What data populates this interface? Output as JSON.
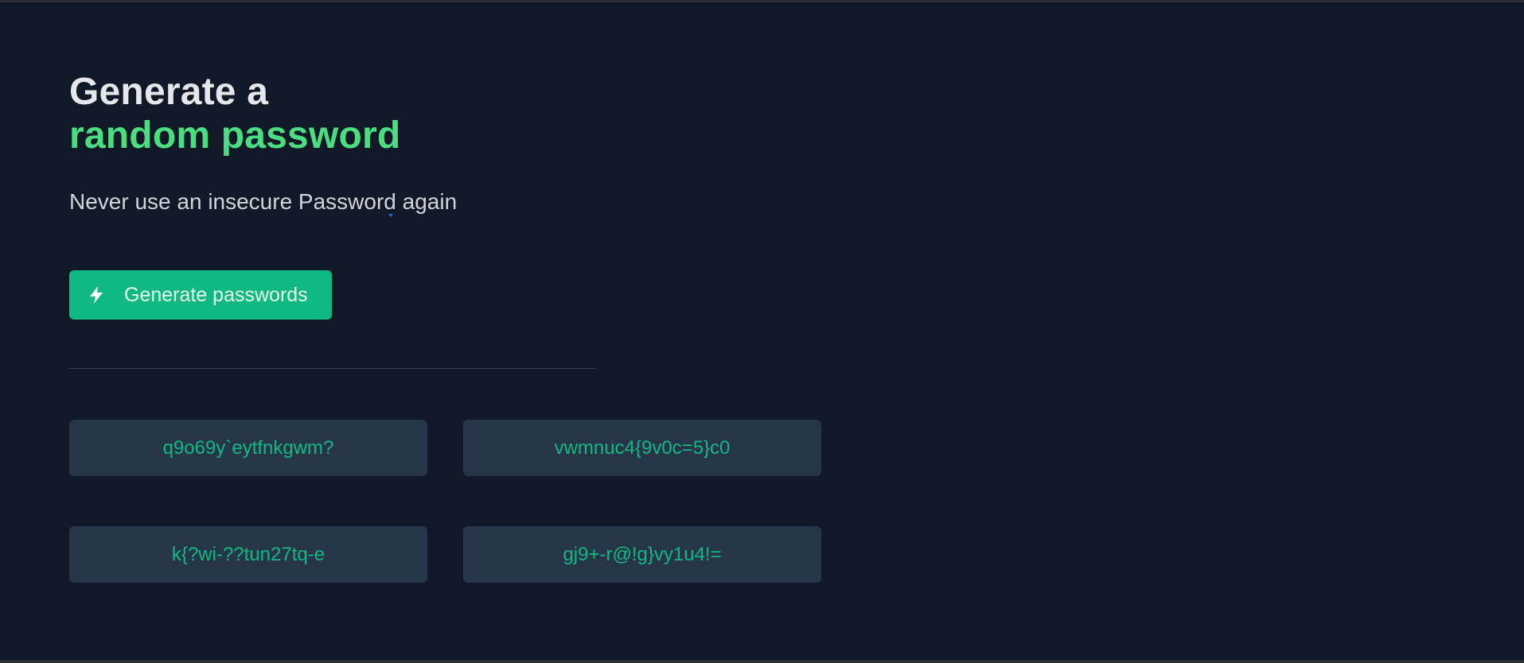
{
  "headline": {
    "line1": "Generate a",
    "line2": "random password"
  },
  "subtitle": "Never use an insecure Password again",
  "generate_button": {
    "label": "Generate passwords",
    "icon": "lightning-bolt-icon"
  },
  "passwords": [
    "q9o69y`eytfnkgwm?",
    "vwmnuc4{9v0c=5}c0",
    "k{?wi-??tun27tq-e",
    "gj9+-r@!g}vy1u4!="
  ],
  "colors": {
    "background": "#111827",
    "accent": "#4ade80",
    "button": "#10b981",
    "card": "#273549",
    "password_text": "#10b981"
  }
}
